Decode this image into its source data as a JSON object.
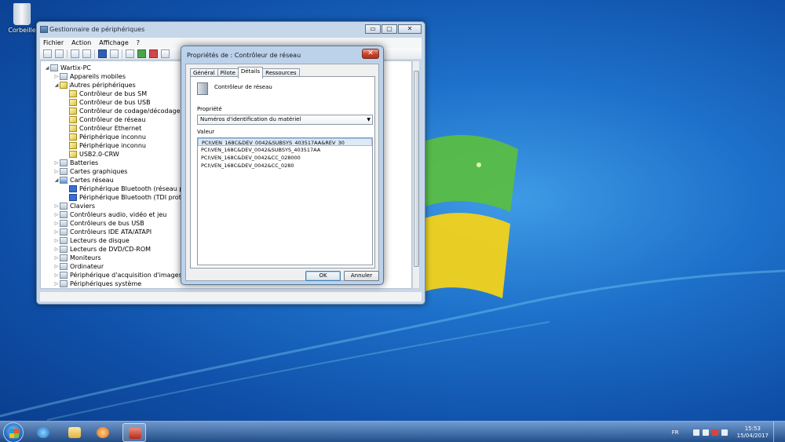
{
  "desktop": {
    "icons": [
      {
        "label": "Corbeille",
        "icon": "recycle-bin-icon"
      }
    ]
  },
  "device_manager": {
    "title": "Gestionnaire de périphériques",
    "controls": {
      "minimize": "▭",
      "maximize": "▢",
      "close": "✕"
    },
    "menu": [
      "Fichier",
      "Action",
      "Affichage",
      "?"
    ],
    "tree": {
      "root": "Wartix-PC",
      "items": [
        {
          "label": "Appareils mobiles",
          "level": 1,
          "state": "collapsed",
          "icon": "mobile-device-icon"
        },
        {
          "label": "Autres périphériques",
          "level": 1,
          "state": "expanded",
          "icon": "warning-device-icon"
        },
        {
          "label": "Contrôleur de bus SM",
          "level": 2,
          "icon": "warning-device-icon"
        },
        {
          "label": "Contrôleur de bus USB",
          "level": 2,
          "icon": "warning-device-icon"
        },
        {
          "label": "Contrôleur de codage/décodage PCI",
          "level": 2,
          "icon": "warning-device-icon"
        },
        {
          "label": "Contrôleur de réseau",
          "level": 2,
          "icon": "warning-device-icon"
        },
        {
          "label": "Contrôleur Ethernet",
          "level": 2,
          "icon": "warning-device-icon"
        },
        {
          "label": "Périphérique inconnu",
          "level": 2,
          "icon": "warning-device-icon"
        },
        {
          "label": "Périphérique inconnu",
          "level": 2,
          "icon": "warning-device-icon"
        },
        {
          "label": "USB2.0-CRW",
          "level": 2,
          "icon": "warning-device-icon"
        },
        {
          "label": "Batteries",
          "level": 1,
          "state": "collapsed",
          "icon": "battery-icon"
        },
        {
          "label": "Cartes graphiques",
          "level": 1,
          "state": "collapsed",
          "icon": "display-adapter-icon"
        },
        {
          "label": "Cartes réseau",
          "level": 1,
          "state": "expanded",
          "icon": "network-adapter-icon"
        },
        {
          "label": "Périphérique Bluetooth (réseau personnel)",
          "level": 2,
          "icon": "bluetooth-icon"
        },
        {
          "label": "Périphérique Bluetooth (TDI protocole)",
          "level": 2,
          "icon": "bluetooth-icon"
        },
        {
          "label": "Claviers",
          "level": 1,
          "state": "collapsed",
          "icon": "keyboard-icon"
        },
        {
          "label": "Contrôleurs audio, vidéo et jeu",
          "level": 1,
          "state": "collapsed",
          "icon": "audio-icon"
        },
        {
          "label": "Contrôleurs de bus USB",
          "level": 1,
          "state": "collapsed",
          "icon": "usb-icon"
        },
        {
          "label": "Contrôleurs IDE ATA/ATAPI",
          "level": 1,
          "state": "collapsed",
          "icon": "ide-icon"
        },
        {
          "label": "Lecteurs de disque",
          "level": 1,
          "state": "collapsed",
          "icon": "disk-drive-icon"
        },
        {
          "label": "Lecteurs de DVD/CD-ROM",
          "level": 1,
          "state": "collapsed",
          "icon": "dvd-drive-icon"
        },
        {
          "label": "Moniteurs",
          "level": 1,
          "state": "collapsed",
          "icon": "monitor-icon"
        },
        {
          "label": "Ordinateur",
          "level": 1,
          "state": "collapsed",
          "icon": "computer-icon"
        },
        {
          "label": "Périphérique d'acquisition d'images",
          "level": 1,
          "state": "collapsed",
          "icon": "camera-icon"
        },
        {
          "label": "Périphériques système",
          "level": 1,
          "state": "collapsed",
          "icon": "system-device-icon"
        }
      ]
    }
  },
  "properties_dialog": {
    "title": "Propriétés de : Contrôleur de réseau",
    "tabs": [
      "Général",
      "Pilote",
      "Détails",
      "Ressources"
    ],
    "active_tab": "Détails",
    "device_name": "Contrôleur de réseau",
    "property_label": "Propriété",
    "property_value": "Numéros d'identification du matériel",
    "value_label": "Valeur",
    "values": [
      "PCI\\VEN_168C&DEV_0042&SUBSYS_403517AA&REV_30",
      "PCI\\VEN_168C&DEV_0042&SUBSYS_403517AA",
      "PCI\\VEN_168C&DEV_0042&CC_028000",
      "PCI\\VEN_168C&DEV_0042&CC_0280"
    ],
    "ok_label": "OK",
    "cancel_label": "Annuler"
  },
  "taskbar": {
    "apps": [
      "ie-icon",
      "explorer-icon",
      "media-player-icon",
      "device-manager-icon"
    ],
    "language": "FR",
    "time": "15:53",
    "date": "15/04/2017"
  }
}
